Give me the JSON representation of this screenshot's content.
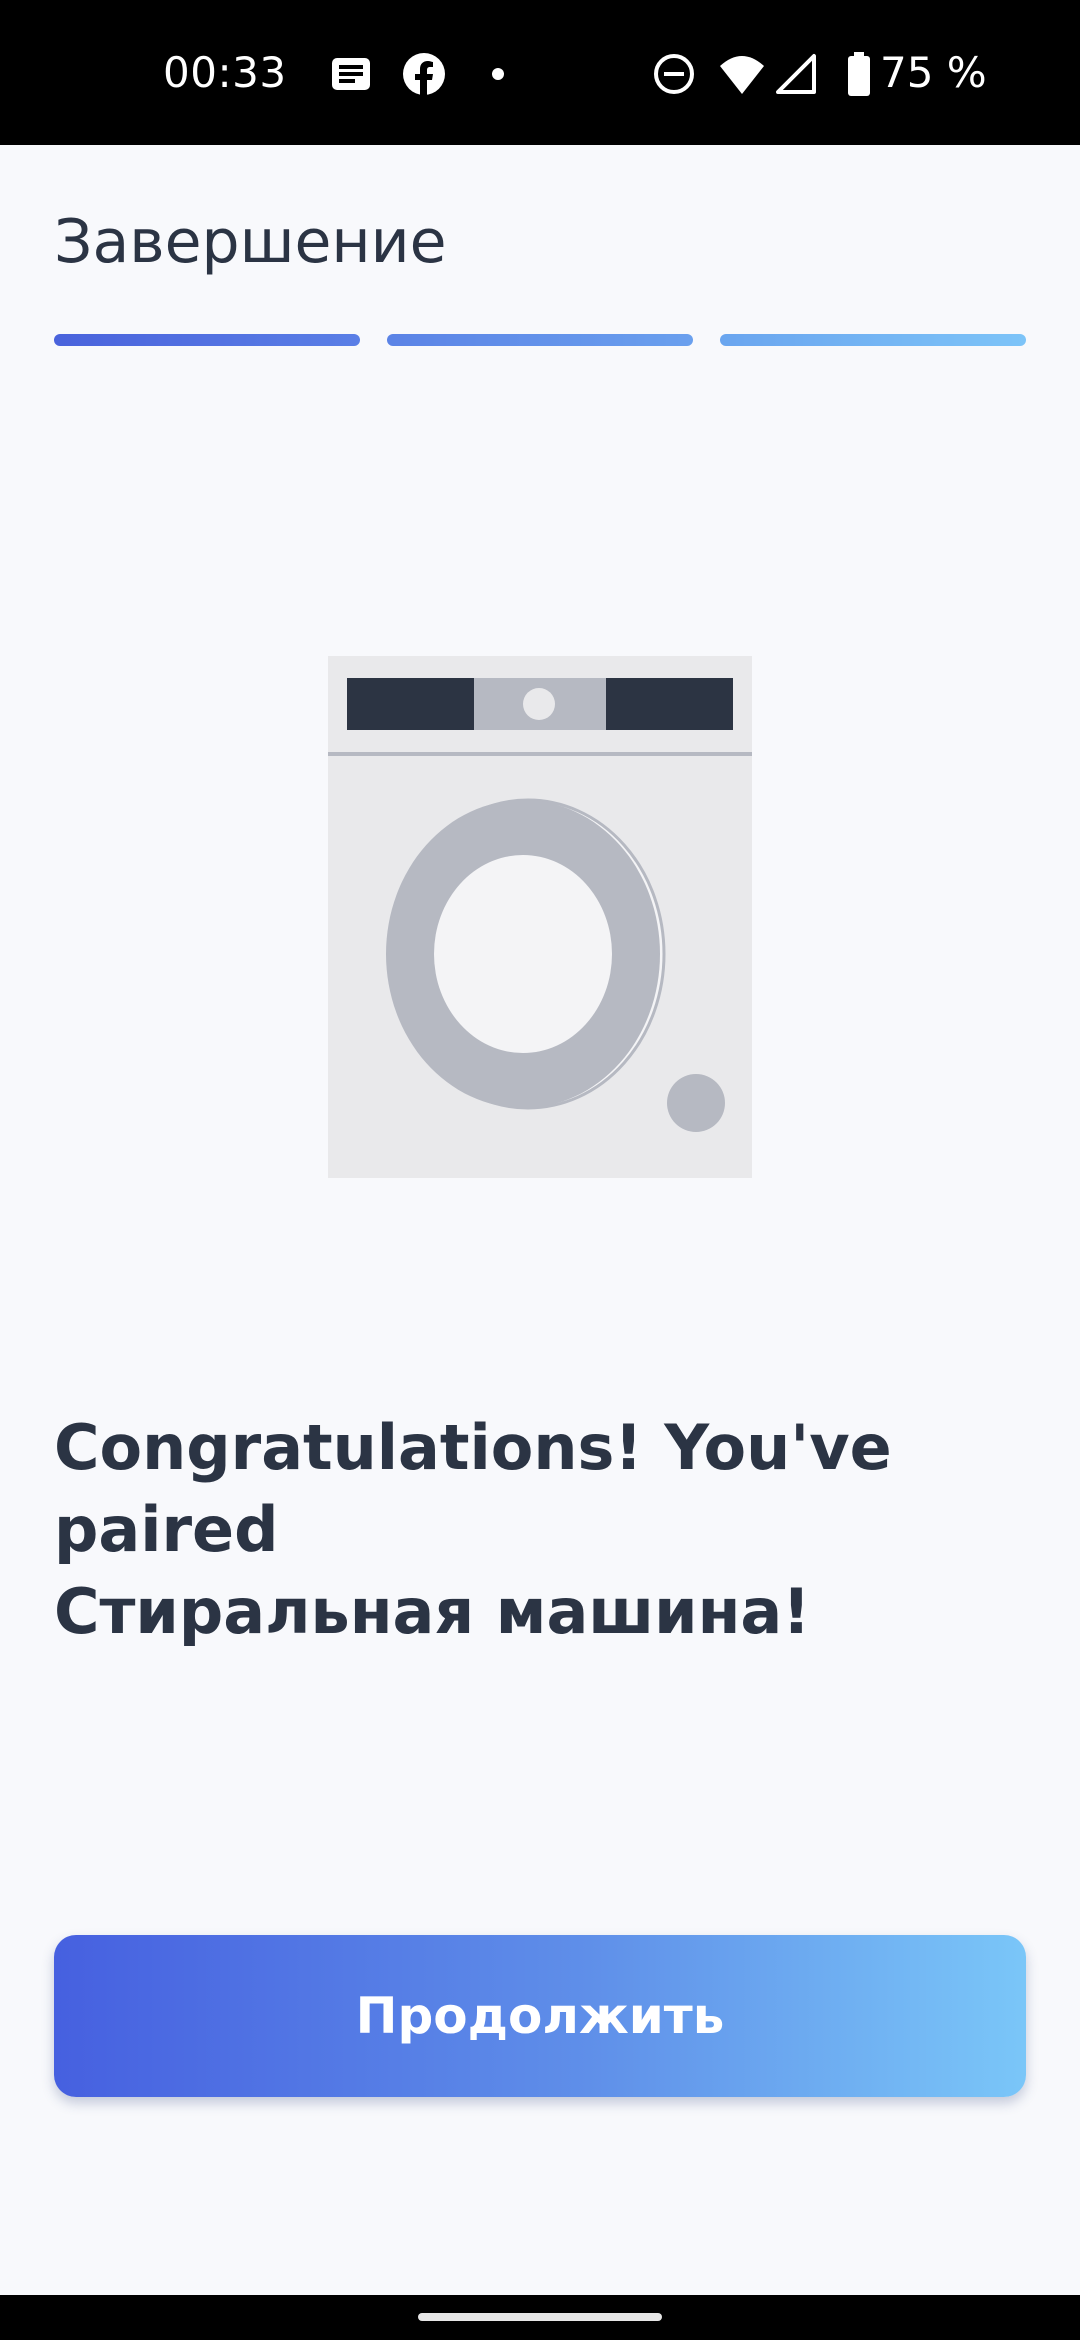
{
  "status_bar": {
    "time": "00:33",
    "battery_percent": "75 %",
    "icons": [
      "notification-icon",
      "facebook-icon",
      "dot-icon",
      "do-not-disturb-icon",
      "wifi-icon",
      "signal-icon",
      "battery-icon"
    ]
  },
  "header": {
    "title": "Завершение"
  },
  "progress": {
    "steps_completed": 3,
    "steps_total": 3
  },
  "illustration": {
    "icon": "washing-machine-icon"
  },
  "message": {
    "line1": "Congratulations! You've paired",
    "line2": "Стиральная машина!"
  },
  "actions": {
    "continue_label": "Продолжить"
  },
  "colors": {
    "background": "#f8f9fc",
    "text": "#2b3444",
    "gradient_start": "#4660e0",
    "gradient_end": "#7ac6f8"
  }
}
